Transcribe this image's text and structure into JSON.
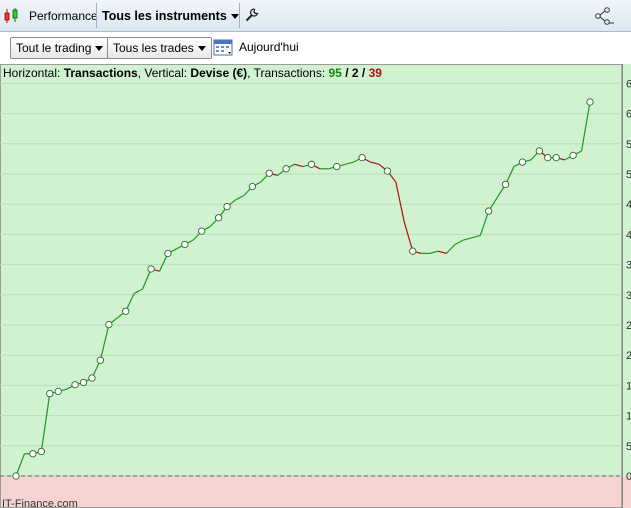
{
  "toolbar": {
    "performance_label": "Performance",
    "instruments_label": "Tous les instruments"
  },
  "filters": {
    "trading_label": "Tout le trading",
    "trades_label": "Tous les trades",
    "today_label": "Aujourd'hui"
  },
  "chart_header": {
    "horizontal_prefix": "Horizontal: ",
    "horizontal_value": "Transactions",
    "vertical_prefix": ", Vertical: ",
    "vertical_value": "Devise (€)",
    "transactions_prefix": ", Transactions: ",
    "count_win": "95",
    "slash1": " / ",
    "count_even": "2",
    "slash2": " / ",
    "count_loss": "39"
  },
  "watermark": "IT-Finance.com",
  "colors": {
    "profit_bg": "#d0f2d0",
    "loss_bg": "#f4d4d2",
    "up_line": "#1a9a1a",
    "down_line": "#b01010",
    "win_count": "#118811",
    "loss_count": "#aa1111"
  },
  "chart_data": {
    "type": "line",
    "y_tick_labels": [
      "6",
      "6",
      "5",
      "5",
      "4",
      "4",
      "3",
      "3",
      "2",
      "2",
      "1",
      "1",
      "5",
      "0"
    ],
    "y_range_note": "y axis values cropped at right edge; only leading digits visible",
    "x": [
      0,
      2,
      4,
      6,
      8,
      10,
      12,
      14,
      16,
      18,
      20,
      22,
      24,
      26,
      28,
      30,
      32,
      34,
      36,
      38,
      40,
      42,
      44,
      46,
      48,
      50,
      52,
      54,
      56,
      58,
      60,
      62,
      64,
      66,
      68,
      70,
      72,
      74,
      76,
      78,
      80,
      82,
      84,
      86,
      88,
      90,
      92,
      94,
      96,
      98,
      100,
      102,
      104,
      106,
      108,
      110,
      112,
      114,
      116,
      118,
      120,
      122,
      124,
      126,
      128,
      130,
      132,
      134,
      136
    ],
    "y": [
      0,
      10,
      10,
      11,
      37,
      38,
      39,
      41,
      42,
      44,
      52,
      68,
      71,
      74,
      82,
      84,
      93,
      92,
      100,
      102,
      104,
      106,
      110,
      112,
      116,
      121,
      124,
      126,
      130,
      132,
      136,
      135,
      138,
      140,
      139,
      140,
      138,
      138,
      139,
      140,
      141,
      143,
      141,
      140,
      137,
      132,
      114,
      101,
      100,
      100,
      101,
      100,
      104,
      106,
      107,
      108,
      119,
      125,
      131,
      139,
      141,
      142,
      146,
      143,
      143,
      142,
      144,
      146,
      168
    ],
    "point_indices": [
      0,
      1,
      2,
      3,
      4,
      5,
      6,
      7,
      8,
      9,
      10,
      11,
      12,
      13,
      14,
      15,
      16,
      17,
      18,
      19,
      20,
      21,
      22,
      23,
      24,
      25,
      26,
      27,
      28,
      29,
      30,
      31,
      32,
      33,
      34,
      35,
      36,
      37,
      38,
      39,
      40,
      41,
      42,
      43,
      44,
      45,
      46,
      47,
      48,
      49,
      50,
      51,
      52,
      53,
      54,
      55,
      56,
      57,
      58,
      59,
      60,
      61,
      62,
      63,
      64,
      65,
      66,
      67,
      68
    ]
  }
}
